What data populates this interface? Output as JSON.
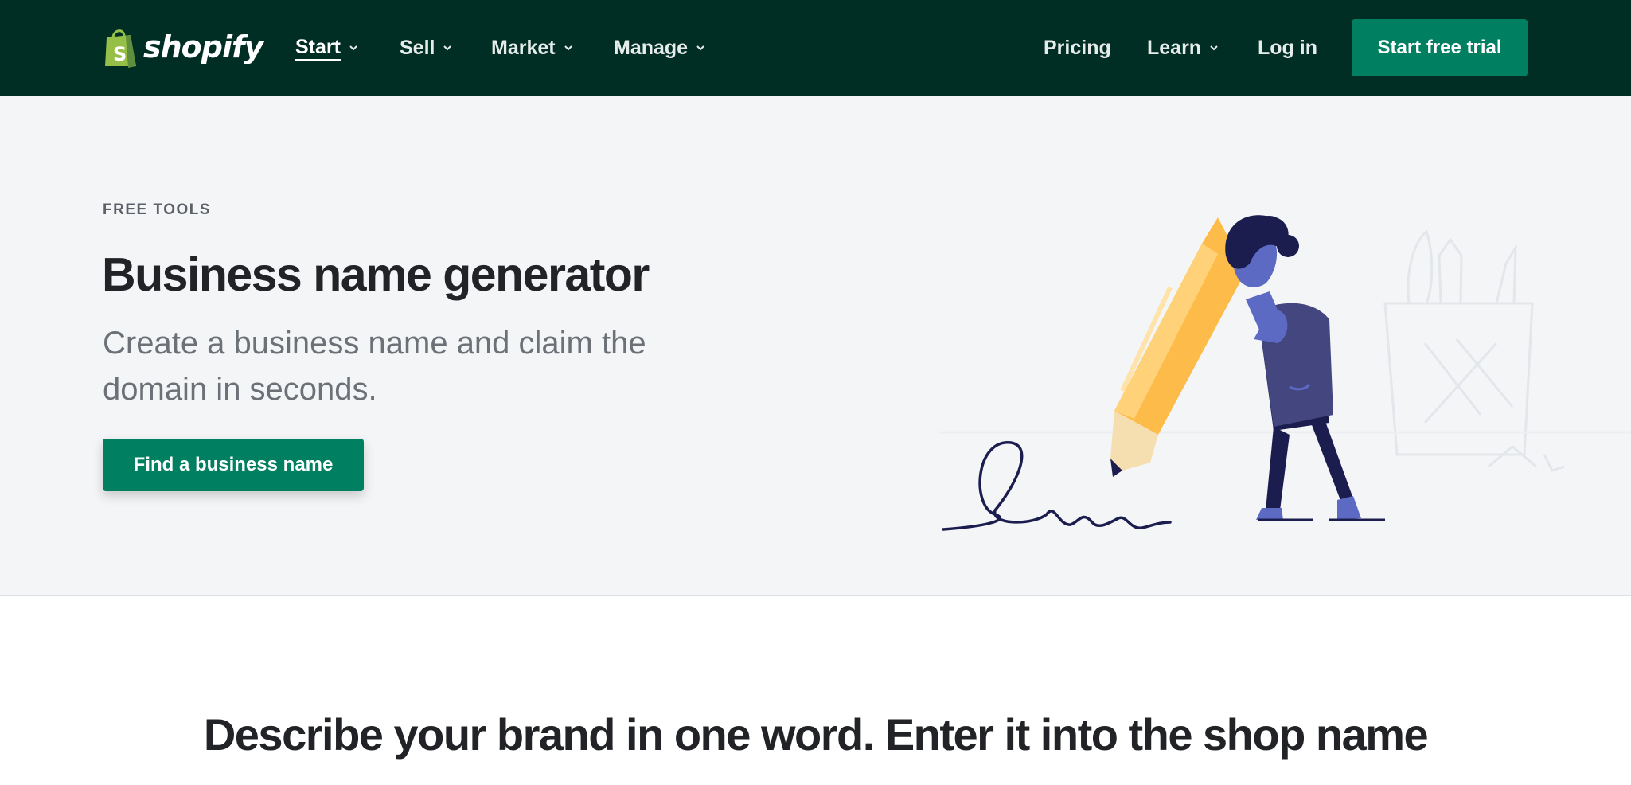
{
  "header": {
    "brand": "shopify",
    "nav": [
      {
        "label": "Start",
        "has_dropdown": true,
        "active": true
      },
      {
        "label": "Sell",
        "has_dropdown": true
      },
      {
        "label": "Market",
        "has_dropdown": true
      },
      {
        "label": "Manage",
        "has_dropdown": true
      }
    ],
    "right_nav": [
      {
        "label": "Pricing"
      },
      {
        "label": "Learn",
        "has_dropdown": true
      },
      {
        "label": "Log in"
      }
    ],
    "cta_label": "Start free trial"
  },
  "hero": {
    "eyebrow": "FREE TOOLS",
    "title": "Business name generator",
    "subtitle": "Create a business name and claim the domain in seconds.",
    "button_label": "Find a business name"
  },
  "section": {
    "heading": "Describe your brand in one word. Enter it into the shop name"
  },
  "colors": {
    "header_bg": "#002e25",
    "brand_green": "#008060",
    "hero_bg": "#f4f5f7",
    "logo_green": "#95bf47",
    "pencil_yellow": "#fdbb4a",
    "figure_purple": "#5c6ac4",
    "figure_dark": "#1c1d4f"
  },
  "icons": {
    "logo": "shopping-bag-icon",
    "caret": "chevron-down-icon"
  }
}
